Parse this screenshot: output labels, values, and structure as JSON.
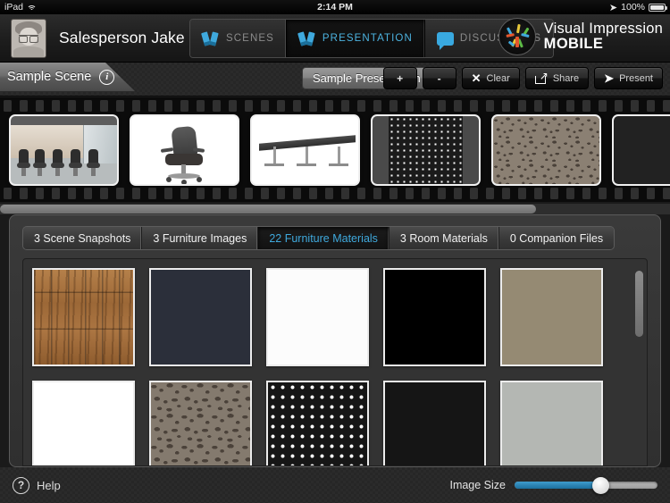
{
  "statusbar": {
    "device": "iPad",
    "wifi_icon": "wifi-icon",
    "time": "2:14 PM",
    "location_icon": "location-arrow-icon",
    "battery_pct": "100%",
    "battery_icon": "battery-icon"
  },
  "header": {
    "avatar_name": "avatar",
    "username": "Salesperson Jake",
    "nav": [
      {
        "label": "SCENES",
        "icon": "scenes-icon",
        "active": false
      },
      {
        "label": "PRESENTATION",
        "icon": "presentation-icon",
        "active": true
      },
      {
        "label": "DISCUSSIONS",
        "icon": "discussions-bubble-icon",
        "active": false
      }
    ],
    "logo": {
      "icon": "visual-impression-logo-icon",
      "line1": "Visual Impression",
      "line2": "MOBILE"
    }
  },
  "toolbar": {
    "scene_name": "Sample Scene",
    "info_icon": "info-icon",
    "info_glyph": "i",
    "presentation_name": "Sample Presentation",
    "buttons": [
      {
        "label": "+",
        "name": "add-button",
        "icon": "plus-icon"
      },
      {
        "label": "-",
        "name": "remove-button",
        "icon": "minus-icon"
      },
      {
        "label": "Clear",
        "name": "clear-button",
        "icon": "close-x-icon",
        "glyph": "✕"
      },
      {
        "label": "Share",
        "name": "share-button",
        "icon": "share-icon"
      },
      {
        "label": "Present",
        "name": "present-button",
        "icon": "play-arrow-icon",
        "glyph": "➤"
      }
    ]
  },
  "filmstrip": {
    "name": "presentation-filmstrip",
    "frames": [
      {
        "name": "frame-scene-photo",
        "kind": "room-photo",
        "alt": "Conference room with mesh office chairs"
      },
      {
        "name": "frame-chair-image",
        "kind": "chair-product",
        "alt": "Black mesh task chair on white background"
      },
      {
        "name": "frame-table-image",
        "kind": "table-product",
        "alt": "Long conference table on white background"
      },
      {
        "name": "frame-dot-material",
        "kind": "dot-material",
        "alt": "Black and white dot pattern material"
      },
      {
        "name": "frame-leopard-material",
        "kind": "leopard-material",
        "alt": "Brown textured pattern material"
      },
      {
        "name": "frame-black-material",
        "kind": "black-material",
        "alt": "Solid dark material"
      }
    ],
    "hscroll_pct": 80
  },
  "panel": {
    "tabs": [
      {
        "label": "3 Scene Snapshots",
        "name": "tab-scene-snapshots",
        "active": false
      },
      {
        "label": "3 Furniture Images",
        "name": "tab-furniture-images",
        "active": false
      },
      {
        "label": "22 Furniture Materials",
        "name": "tab-furniture-materials",
        "active": true
      },
      {
        "label": "3 Room Materials",
        "name": "tab-room-materials",
        "active": false
      },
      {
        "label": "0 Companion Files",
        "name": "tab-companion-files",
        "active": false
      }
    ],
    "swatches": [
      {
        "name": "material-swatch-wood",
        "kind": "wood",
        "alt": "Wood plank flooring"
      },
      {
        "name": "material-swatch-navy",
        "kind": "navy",
        "alt": "Dark navy fabric"
      },
      {
        "name": "material-swatch-white",
        "kind": "white",
        "alt": "White surface"
      },
      {
        "name": "material-swatch-black",
        "kind": "black",
        "alt": "Black surface"
      },
      {
        "name": "material-swatch-khaki",
        "kind": "khaki",
        "alt": "Khaki tan fabric"
      },
      {
        "name": "material-swatch-purewhite",
        "kind": "purewhite",
        "alt": "Plain white"
      },
      {
        "name": "material-swatch-leopard",
        "kind": "leopard",
        "alt": "Brown animal-print texture"
      },
      {
        "name": "material-swatch-dots",
        "kind": "dots",
        "alt": "Black with white dot grid"
      },
      {
        "name": "material-swatch-deepblack",
        "kind": "deepblack",
        "alt": "Deep black surface"
      },
      {
        "name": "material-swatch-gray",
        "kind": "gray",
        "alt": "Light gray surface"
      }
    ],
    "vscroll_pct": 8
  },
  "bottombar": {
    "help_icon": "help-question-icon",
    "help_glyph": "?",
    "help_label": "Help",
    "image_size_label": "Image Size",
    "image_size_value": 60
  },
  "colors": {
    "accent_blue": "#3fa9dd",
    "panel_bg": "#333333",
    "toolbar_bg": "#262626"
  }
}
